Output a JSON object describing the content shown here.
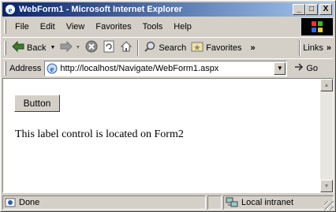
{
  "window": {
    "title": "WebForm1 - Microsoft Internet Explorer",
    "minimize": "_",
    "maximize": "□",
    "close": "X"
  },
  "menu": [
    "File",
    "Edit",
    "View",
    "Favorites",
    "Tools",
    "Help"
  ],
  "toolbar": {
    "back_label": "Back",
    "search_label": "Search",
    "favorites_label": "Favorites",
    "more": "»",
    "links_label": "Links",
    "links_more": "»"
  },
  "address": {
    "label": "Address",
    "url": "http://localhost/Navigate/WebForm1.aspx",
    "go_label": "Go"
  },
  "page": {
    "button_label": "Button",
    "label_text": "This label control is located on Form2"
  },
  "status": {
    "text": "Done",
    "zone": "Local intranet"
  },
  "icons": {
    "back": "back-arrow-icon",
    "forward": "forward-arrow-icon",
    "stop": "stop-icon",
    "refresh": "refresh-icon",
    "home": "home-icon",
    "search": "search-icon",
    "favorites": "favorites-icon",
    "ie": "ie-page-icon",
    "go": "go-arrow-icon",
    "zone": "local-intranet-icon"
  },
  "colors": {
    "title_start": "#0a246a",
    "title_end": "#a6caf0",
    "chrome": "#d4d0c8"
  }
}
